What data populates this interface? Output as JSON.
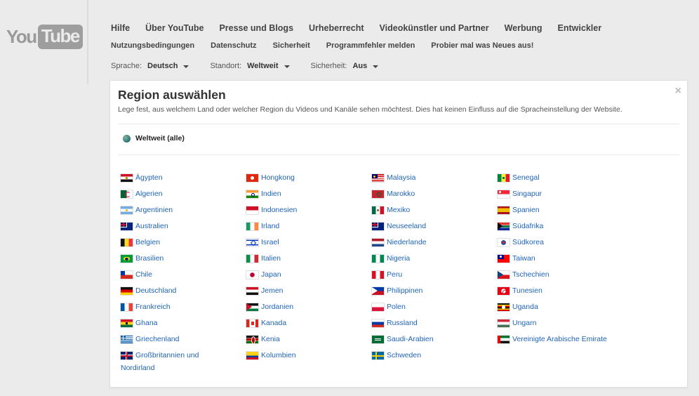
{
  "logo": {
    "you": "You",
    "tube": "Tube"
  },
  "nav": {
    "primary": [
      "Hilfe",
      "Über YouTube",
      "Presse und Blogs",
      "Urheberrecht",
      "Videokünstler und Partner",
      "Werbung",
      "Entwickler"
    ],
    "secondary": [
      "Nutzungsbedingungen",
      "Datenschutz",
      "Sicherheit",
      "Programmfehler melden",
      "Probier mal was Neues aus!"
    ]
  },
  "settings": {
    "language_label": "Sprache:",
    "language_value": "Deutsch",
    "location_label": "Standort:",
    "location_value": "Weltweit",
    "safety_label": "Sicherheit:",
    "safety_value": "Aus"
  },
  "panel": {
    "title": "Region auswählen",
    "description": "Lege fest, aus welchem Land oder welcher Region du Videos und Kanäle sehen möchtest. Dies hat keinen Einfluss auf die Spracheinstellung der Website.",
    "close": "×",
    "worldwide": "Weltweit (alle)"
  },
  "countries": {
    "col1": [
      {
        "name": "Ägypten",
        "flag": "eg"
      },
      {
        "name": "Algerien",
        "flag": "dz"
      },
      {
        "name": "Argentinien",
        "flag": "ar"
      },
      {
        "name": "Australien",
        "flag": "au"
      },
      {
        "name": "Belgien",
        "flag": "be"
      },
      {
        "name": "Brasilien",
        "flag": "br"
      },
      {
        "name": "Chile",
        "flag": "cl"
      },
      {
        "name": "Deutschland",
        "flag": "de"
      },
      {
        "name": "Frankreich",
        "flag": "fr"
      },
      {
        "name": "Ghana",
        "flag": "gh"
      },
      {
        "name": "Griechenland",
        "flag": "gr"
      },
      {
        "name": "Großbritannien und",
        "cont": "Nordirland",
        "flag": "gb"
      }
    ],
    "col2": [
      {
        "name": "Hongkong",
        "flag": "hk"
      },
      {
        "name": "Indien",
        "flag": "in"
      },
      {
        "name": "Indonesien",
        "flag": "id"
      },
      {
        "name": "Irland",
        "flag": "ie"
      },
      {
        "name": "Israel",
        "flag": "il"
      },
      {
        "name": "Italien",
        "flag": "it"
      },
      {
        "name": "Japan",
        "flag": "jp"
      },
      {
        "name": "Jemen",
        "flag": "ye"
      },
      {
        "name": "Jordanien",
        "flag": "jo"
      },
      {
        "name": "Kanada",
        "flag": "ca"
      },
      {
        "name": "Kenia",
        "flag": "ke"
      },
      {
        "name": "Kolumbien",
        "flag": "co"
      }
    ],
    "col3": [
      {
        "name": "Malaysia",
        "flag": "my"
      },
      {
        "name": "Marokko",
        "flag": "ma"
      },
      {
        "name": "Mexiko",
        "flag": "mx"
      },
      {
        "name": "Neuseeland",
        "flag": "nz"
      },
      {
        "name": "Niederlande",
        "flag": "nl"
      },
      {
        "name": "Nigeria",
        "flag": "ng"
      },
      {
        "name": "Peru",
        "flag": "pe"
      },
      {
        "name": "Philippinen",
        "flag": "ph"
      },
      {
        "name": "Polen",
        "flag": "pl"
      },
      {
        "name": "Russland",
        "flag": "ru"
      },
      {
        "name": "Saudi-Arabien",
        "flag": "sa"
      },
      {
        "name": "Schweden",
        "flag": "se"
      }
    ],
    "col4": [
      {
        "name": "Senegal",
        "flag": "sn"
      },
      {
        "name": "Singapur",
        "flag": "sg"
      },
      {
        "name": "Spanien",
        "flag": "es"
      },
      {
        "name": "Südafrika",
        "flag": "za"
      },
      {
        "name": "Südkorea",
        "flag": "kr"
      },
      {
        "name": "Taiwan",
        "flag": "tw"
      },
      {
        "name": "Tschechien",
        "flag": "cz"
      },
      {
        "name": "Tunesien",
        "flag": "tn"
      },
      {
        "name": "Uganda",
        "flag": "ug"
      },
      {
        "name": "Ungarn",
        "flag": "hu"
      },
      {
        "name": "Vereinigte Arabische Emirate",
        "flag": "ae"
      }
    ]
  },
  "colors": {
    "link": "#1f64b8",
    "background": "#ebebeb",
    "panel": "#ffffff"
  }
}
